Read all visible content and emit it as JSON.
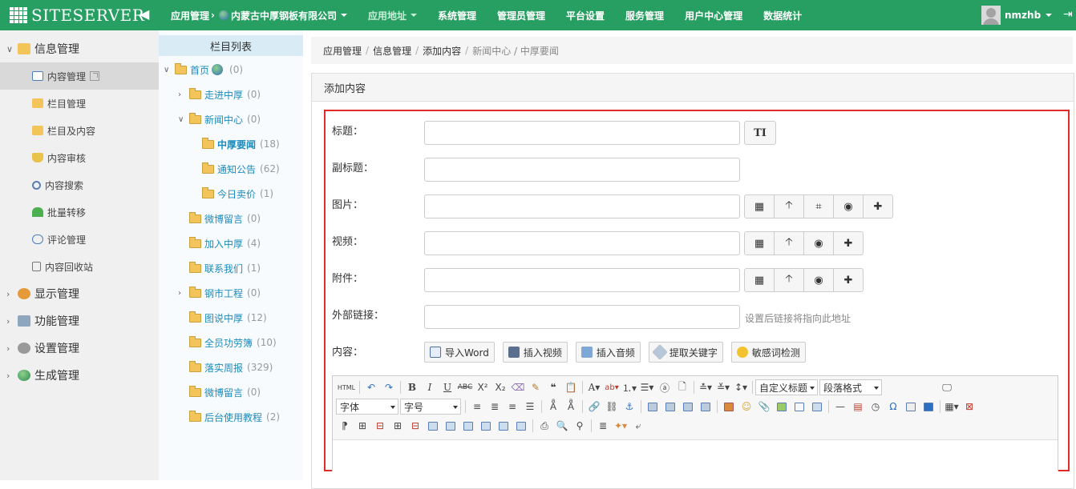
{
  "app": {
    "logo_text": "SITESERVER",
    "user_name": "nmzhb"
  },
  "topnav": [
    {
      "label": "应用管理",
      "suffix": "内蒙古中厚钢板有限公司"
    },
    {
      "label": "应用地址"
    },
    {
      "label": "系统管理"
    },
    {
      "label": "管理员管理"
    },
    {
      "label": "平台设置"
    },
    {
      "label": "服务管理"
    },
    {
      "label": "用户中心管理"
    },
    {
      "label": "数据统计"
    }
  ],
  "sidebar": {
    "section_info": "信息管理",
    "items": [
      {
        "label": "内容管理"
      },
      {
        "label": "栏目管理"
      },
      {
        "label": "栏目及内容"
      },
      {
        "label": "内容审核"
      },
      {
        "label": "内容搜索"
      },
      {
        "label": "批量转移"
      },
      {
        "label": "评论管理"
      },
      {
        "label": "内容回收站"
      }
    ],
    "sections": [
      {
        "label": "显示管理"
      },
      {
        "label": "功能管理"
      },
      {
        "label": "设置管理"
      },
      {
        "label": "生成管理"
      }
    ]
  },
  "tree": {
    "header": "栏目列表",
    "nodes": [
      {
        "label": "首页",
        "count": "(0)"
      },
      {
        "label": "走进中厚",
        "count": "(0)"
      },
      {
        "label": "新闻中心",
        "count": "(0)"
      },
      {
        "label": "中厚要闻",
        "count": "(18)"
      },
      {
        "label": "通知公告",
        "count": "(62)"
      },
      {
        "label": "今日卖价",
        "count": "(1)"
      },
      {
        "label": "微博留言",
        "count": "(0)"
      },
      {
        "label": "加入中厚",
        "count": "(4)"
      },
      {
        "label": "联系我们",
        "count": "(1)"
      },
      {
        "label": "钢市工程",
        "count": "(0)"
      },
      {
        "label": "图说中厚",
        "count": "(12)"
      },
      {
        "label": "全员功劳簿",
        "count": "(10)"
      },
      {
        "label": "落实周报",
        "count": "(329)"
      },
      {
        "label": "微博留言",
        "count": "(0)"
      },
      {
        "label": "后台使用教程",
        "count": "(2)"
      }
    ]
  },
  "breadcrumb": {
    "items": [
      "应用管理",
      "信息管理",
      "添加内容"
    ],
    "last": "新闻中心 / 中厚要闻"
  },
  "panel": {
    "title": "添加内容"
  },
  "form": {
    "title_label": "标题：",
    "subtitle_label": "副标题：",
    "image_label": "图片：",
    "video_label": "视频：",
    "attachment_label": "附件：",
    "link_label": "外部链接：",
    "link_hint": "设置后链接将指向此地址",
    "content_label": "内容：",
    "title_format_btn": "TI"
  },
  "content_tools": [
    {
      "label": "导入Word"
    },
    {
      "label": "插入视频"
    },
    {
      "label": "插入音频"
    },
    {
      "label": "提取关键字"
    },
    {
      "label": "敏感词检测"
    }
  ],
  "editor": {
    "html_btn": "HTML",
    "custom_title_select": "自定义标题",
    "paragraph_select": "段落格式",
    "font_select": "字体",
    "size_select": "字号"
  }
}
